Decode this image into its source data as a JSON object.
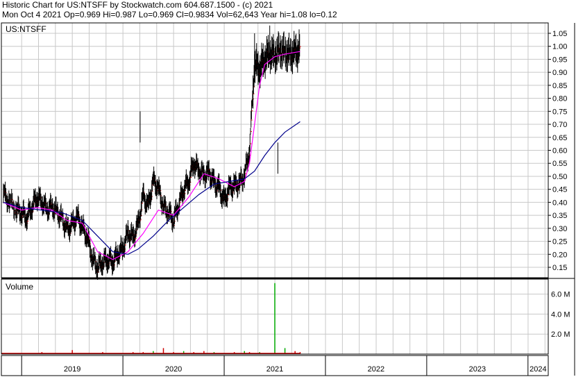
{
  "header": {
    "line1": "Historic Chart for US:NTSFF by Stockwatch.com 604.687.1500 - (c) 2021",
    "line2": "Mon Oct  4 2021  Op=0.969  Hi=0.987  Lo=0.969  Cl=0.9834  Vol=62,643  Year hi=1.08  lo=0.12"
  },
  "chart_data": [
    {
      "type": "line",
      "panel": "price",
      "symbol_label": "US:NTSFF",
      "ylim": [
        0.11,
        1.09
      ],
      "y_ticks": [
        "1.05",
        "1.00",
        "0.95",
        "0.90",
        "0.85",
        "0.80",
        "0.75",
        "0.70",
        "0.65",
        "0.60",
        "0.55",
        "0.50",
        "0.45",
        "0.40",
        "0.35",
        "0.30",
        "0.25",
        "0.20",
        "0.15"
      ],
      "x_ticks": [
        "2019",
        "2020",
        "2021",
        "2022",
        "2023",
        "2024"
      ],
      "x_range": [
        2018.8,
        2024.2
      ],
      "grid": true,
      "series": [
        {
          "style": "ohlc-bars",
          "color": "#000000",
          "x": [
            2018.82,
            2018.88,
            2018.95,
            2019.0,
            2019.05,
            2019.1,
            2019.15,
            2019.2,
            2019.25,
            2019.3,
            2019.35,
            2019.4,
            2019.45,
            2019.5,
            2019.55,
            2019.6,
            2019.65,
            2019.7,
            2019.75,
            2019.8,
            2019.85,
            2019.9,
            2019.95,
            2020.0,
            2020.05,
            2020.1,
            2020.15,
            2020.2,
            2020.25,
            2020.3,
            2020.35,
            2020.4,
            2020.45,
            2020.5,
            2020.55,
            2020.6,
            2020.65,
            2020.7,
            2020.75,
            2020.8,
            2020.85,
            2020.9,
            2020.95,
            2021.0,
            2021.05,
            2021.1,
            2021.15,
            2021.2,
            2021.25,
            2021.3,
            2021.35,
            2021.4,
            2021.45,
            2021.5,
            2021.55,
            2021.6,
            2021.65,
            2021.7,
            2021.75
          ],
          "close": [
            0.43,
            0.4,
            0.37,
            0.36,
            0.34,
            0.38,
            0.42,
            0.4,
            0.37,
            0.38,
            0.36,
            0.33,
            0.29,
            0.31,
            0.34,
            0.3,
            0.26,
            0.18,
            0.15,
            0.17,
            0.18,
            0.17,
            0.2,
            0.22,
            0.28,
            0.26,
            0.31,
            0.42,
            0.38,
            0.48,
            0.45,
            0.38,
            0.36,
            0.33,
            0.39,
            0.45,
            0.48,
            0.55,
            0.52,
            0.5,
            0.51,
            0.47,
            0.45,
            0.4,
            0.45,
            0.46,
            0.47,
            0.5,
            0.6,
            0.93,
            0.91,
            0.95,
            0.97,
            0.96,
            0.98,
            0.97,
            0.96,
            0.97,
            0.98
          ]
        },
        {
          "name": "",
          "style": "moving-average-short",
          "color": "#ff00ff",
          "x": [
            2018.82,
            2019.0,
            2019.15,
            2019.3,
            2019.45,
            2019.6,
            2019.75,
            2019.9,
            2020.05,
            2020.2,
            2020.35,
            2020.5,
            2020.65,
            2020.8,
            2020.95,
            2021.1,
            2021.2,
            2021.25,
            2021.3,
            2021.35,
            2021.4,
            2021.5,
            2021.6,
            2021.75
          ],
          "y": [
            0.4,
            0.37,
            0.38,
            0.37,
            0.33,
            0.32,
            0.21,
            0.18,
            0.21,
            0.28,
            0.37,
            0.35,
            0.42,
            0.51,
            0.49,
            0.46,
            0.48,
            0.55,
            0.7,
            0.85,
            0.93,
            0.96,
            0.97,
            0.98
          ]
        },
        {
          "name": "",
          "style": "moving-average-long",
          "color": "#00008b",
          "x": [
            2018.82,
            2019.0,
            2019.2,
            2019.4,
            2019.6,
            2019.75,
            2019.9,
            2020.05,
            2020.15,
            2020.3,
            2020.45,
            2020.6,
            2020.75,
            2020.9,
            2021.05,
            2021.2,
            2021.3,
            2021.4,
            2021.5,
            2021.6,
            2021.75
          ],
          "y": [
            0.4,
            0.38,
            0.37,
            0.36,
            0.33,
            0.27,
            0.21,
            0.2,
            0.22,
            0.27,
            0.33,
            0.38,
            0.43,
            0.47,
            0.48,
            0.49,
            0.52,
            0.58,
            0.63,
            0.67,
            0.71
          ]
        }
      ]
    },
    {
      "type": "bar",
      "panel": "volume",
      "title": "Volume",
      "ylim": [
        0,
        7.5
      ],
      "y_ticks": [
        "6.0 M",
        "4.0 M",
        "2.0 M"
      ],
      "y_tick_values": [
        6,
        4,
        2
      ],
      "units": "M",
      "bar_color_up": "#00aa00",
      "bar_color_down": "#cc0000",
      "x": [
        2018.82,
        2018.9,
        2019.0,
        2019.1,
        2019.2,
        2019.3,
        2019.4,
        2019.5,
        2019.6,
        2019.7,
        2019.8,
        2019.9,
        2020.0,
        2020.1,
        2020.2,
        2020.3,
        2020.4,
        2020.5,
        2020.6,
        2020.7,
        2020.8,
        2020.9,
        2021.0,
        2021.1,
        2021.2,
        2021.25,
        2021.3,
        2021.35,
        2021.4,
        2021.5,
        2021.6,
        2021.7,
        2021.75
      ],
      "values": [
        0.1,
        0.1,
        0.1,
        0.1,
        0.2,
        0.1,
        0.1,
        0.4,
        0.1,
        0.1,
        0.2,
        0.1,
        0.1,
        0.2,
        0.2,
        0.3,
        0.6,
        0.2,
        0.3,
        0.2,
        0.3,
        0.2,
        0.1,
        0.2,
        0.3,
        0.2,
        0.1,
        0.2,
        0.1,
        7.1,
        0.6,
        0.3,
        0.2
      ]
    }
  ]
}
